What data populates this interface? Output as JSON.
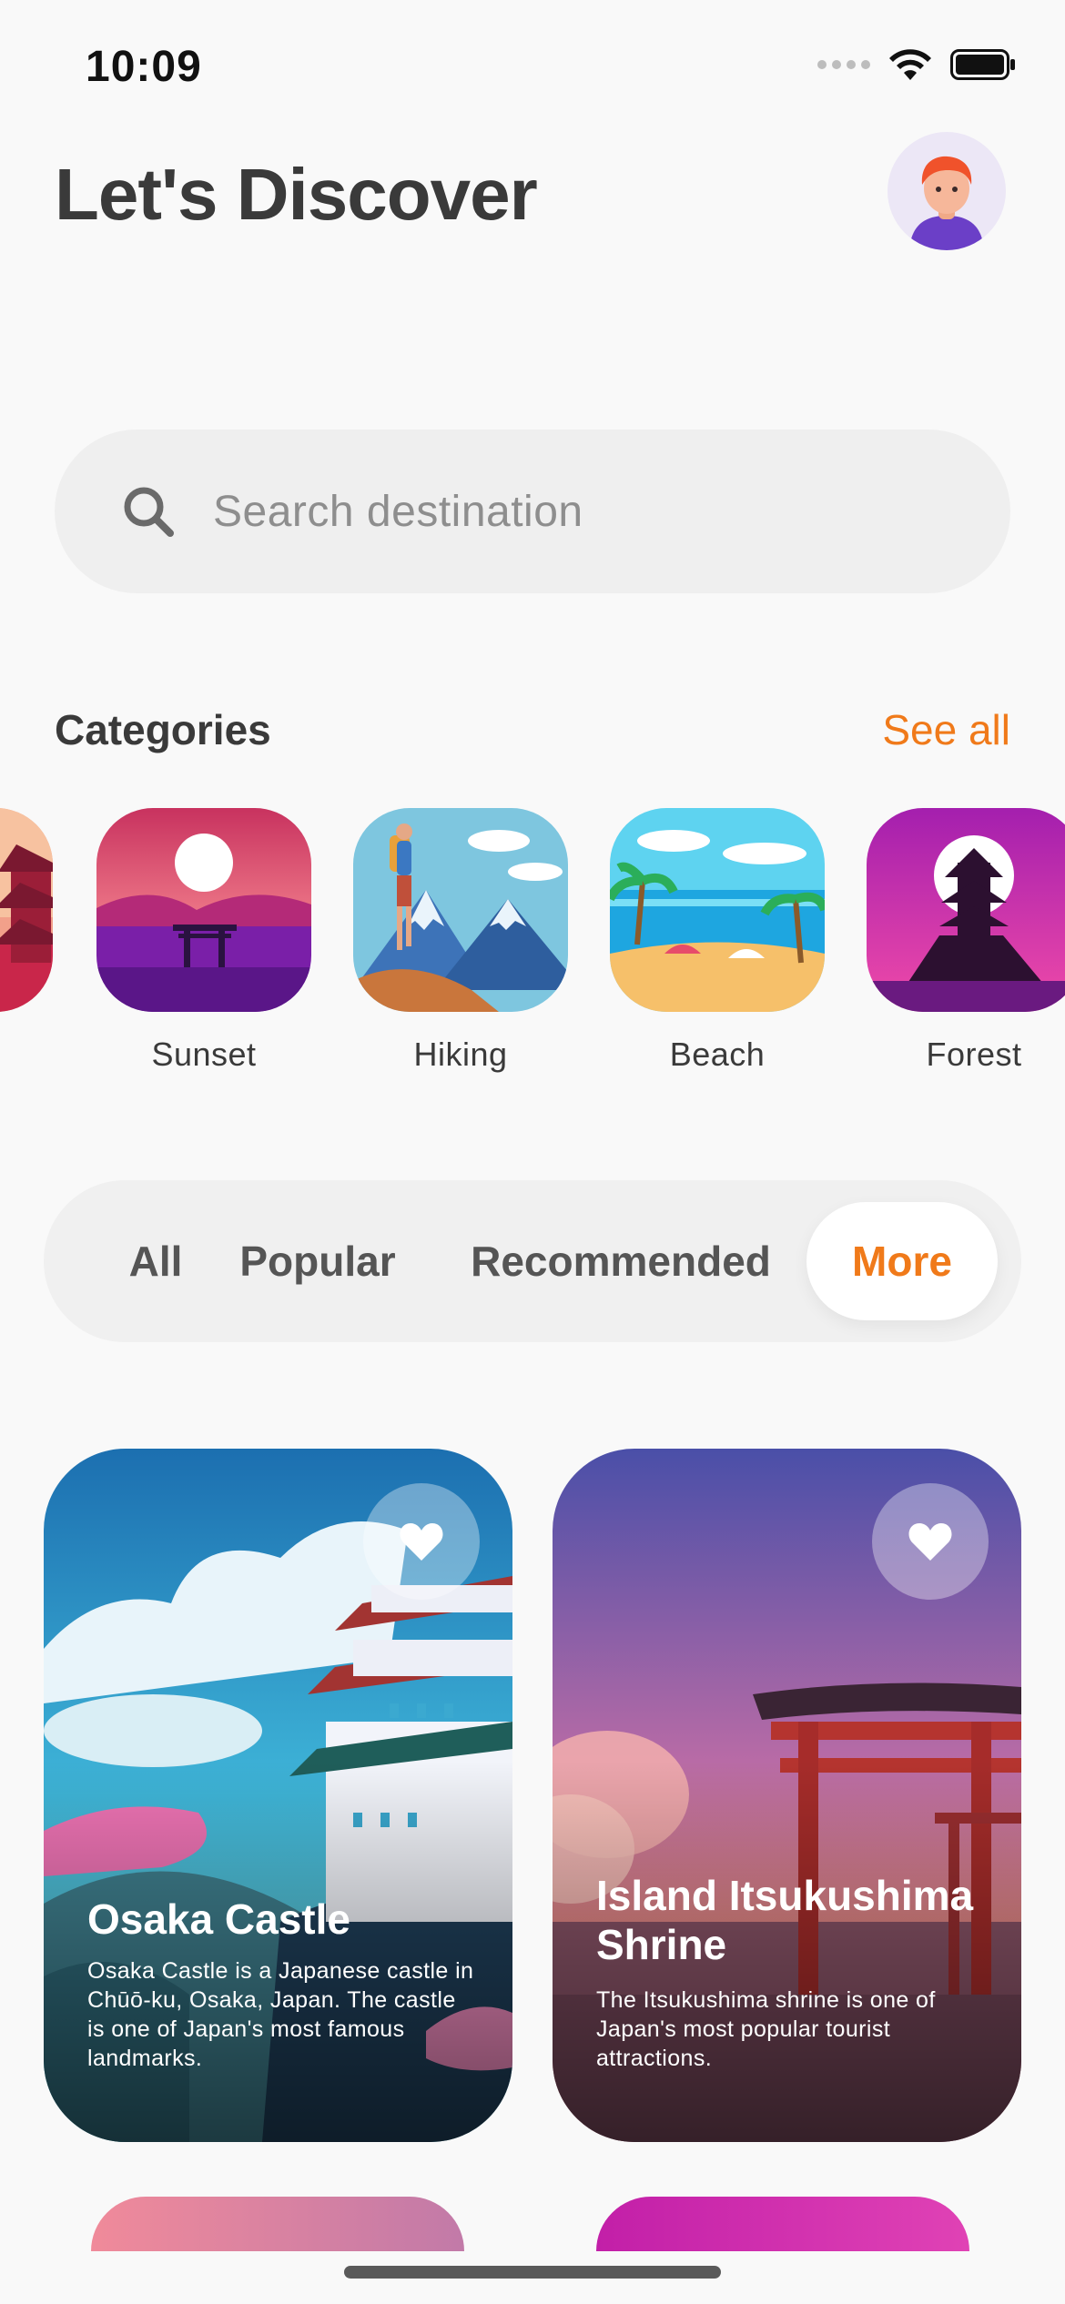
{
  "status_bar": {
    "time": "10:09"
  },
  "header": {
    "title": "Let's Discover"
  },
  "search": {
    "placeholder": "Search destination"
  },
  "categories": {
    "heading": "Categories",
    "see_all": "See all",
    "items": [
      {
        "label": "Sunset"
      },
      {
        "label": "Hiking"
      },
      {
        "label": "Beach"
      },
      {
        "label": "Forest"
      }
    ]
  },
  "tabs": {
    "items": [
      "All",
      "Popular",
      "Recommended",
      "More"
    ],
    "selected": "More"
  },
  "cards": [
    {
      "title": "Osaka Castle",
      "description": "Osaka Castle is a Japanese castle in Chūō-ku, Osaka, Japan. The castle is one of Japan's most famous landmarks."
    },
    {
      "title": "Island Itsukushima Shrine",
      "description": "The Itsukushima shrine is one of Japan's most popular tourist attractions."
    }
  ],
  "colors": {
    "accent": "#F07A1A",
    "background": "#F9F9F9",
    "text": "#3A3A3A"
  },
  "icons": [
    "search-icon",
    "wifi-icon",
    "battery-icon",
    "heart-icon",
    "avatar-icon"
  ]
}
